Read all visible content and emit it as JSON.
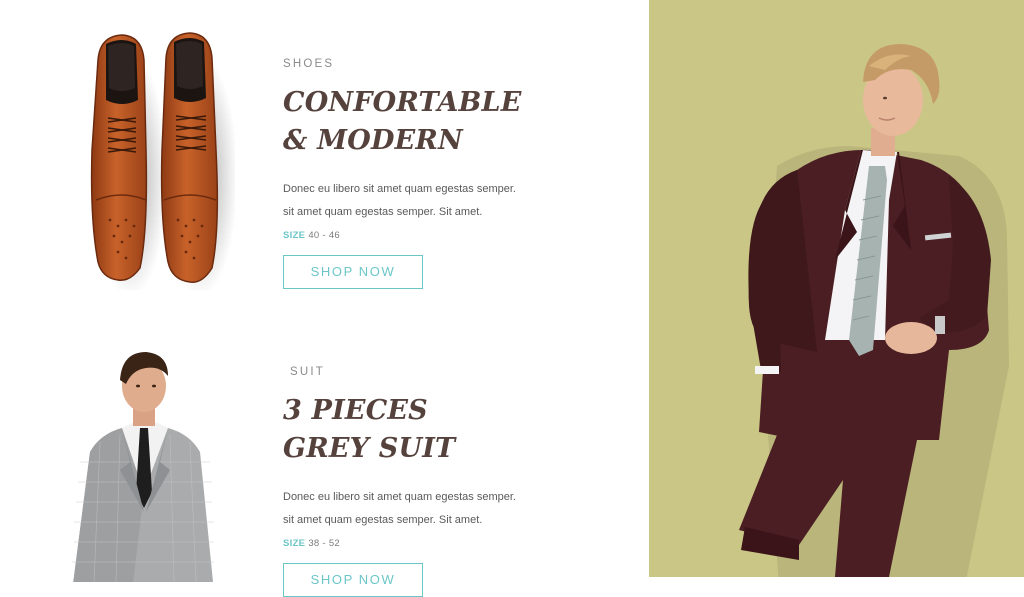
{
  "products": [
    {
      "category": "SHOES",
      "title_line1": "CONFORTABLE",
      "title_line2": "& MODERN",
      "desc_line1": "Donec eu libero sit amet quam egestas semper.",
      "desc_line2": "sit amet quam egestas semper. Sit amet.",
      "size_label": "SIZE",
      "size_value": "40 - 46",
      "button_label": "SHOP NOW"
    },
    {
      "category": "SUIT",
      "title_line1": "3 PIECES",
      "title_line2": "GREY SUIT",
      "desc_line1": "Donec eu libero sit amet quam egestas semper.",
      "desc_line2": "sit amet quam egestas semper. Sit amet.",
      "size_label": "SIZE",
      "size_value": "38 - 52",
      "button_label": "SHOP NOW"
    }
  ],
  "colors": {
    "panel_bg": "#cac686",
    "title": "#55423d",
    "accent": "#6cc6c8",
    "suit": "#4a1e22"
  }
}
